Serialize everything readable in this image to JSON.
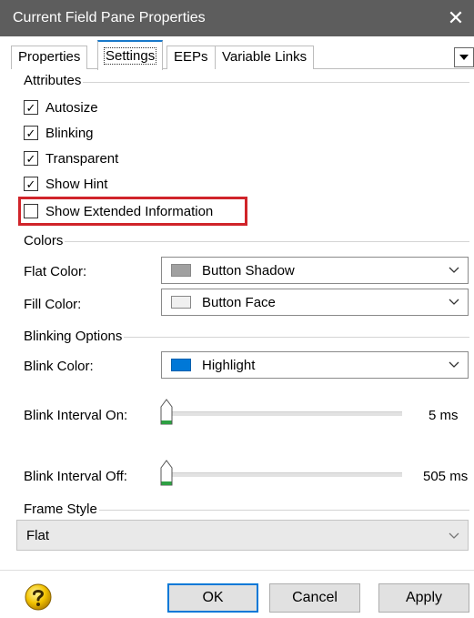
{
  "window": {
    "title": "Current Field Pane Properties",
    "close_glyph": "✕"
  },
  "tabs": [
    {
      "label": "Properties",
      "active": false
    },
    {
      "label": "Settings",
      "active": true
    },
    {
      "label": "EEPs",
      "active": false
    },
    {
      "label": "Variable Links",
      "active": false
    }
  ],
  "attributes": {
    "label": "Attributes",
    "items": [
      {
        "label": "Autosize",
        "checked": true
      },
      {
        "label": "Blinking",
        "checked": true
      },
      {
        "label": "Transparent",
        "checked": true
      },
      {
        "label": "Show Hint",
        "checked": true
      },
      {
        "label": "Show Extended Information",
        "checked": false
      }
    ]
  },
  "colors": {
    "label": "Colors",
    "flat_color": {
      "label": "Flat Color:",
      "value": "Button Shadow",
      "swatch": "#a0a0a0"
    },
    "fill_color": {
      "label": "Fill Color:",
      "value": "Button Face",
      "swatch": "#f0f0f0"
    }
  },
  "blinking": {
    "label": "Blinking Options",
    "blink_color": {
      "label": "Blink Color:",
      "value": "Highlight",
      "swatch": "#0078d7"
    },
    "interval_on": {
      "label": "Blink Interval On:",
      "value": "5 ms"
    },
    "interval_off": {
      "label": "Blink Interval Off:",
      "value": "505 ms"
    }
  },
  "frame_style": {
    "label": "Frame Style",
    "value": "Flat"
  },
  "buttons": {
    "ok": "OK",
    "cancel": "Cancel",
    "apply": "Apply"
  },
  "icons": {
    "help": "help-question-icon",
    "close": "close-icon",
    "chevron": "chevron-down-icon"
  },
  "colors_ui": {
    "accent": "#0078d7",
    "highlight_border": "#d0242a",
    "titlebar": "#5d5d5d",
    "slider_green": "#2ea043"
  }
}
